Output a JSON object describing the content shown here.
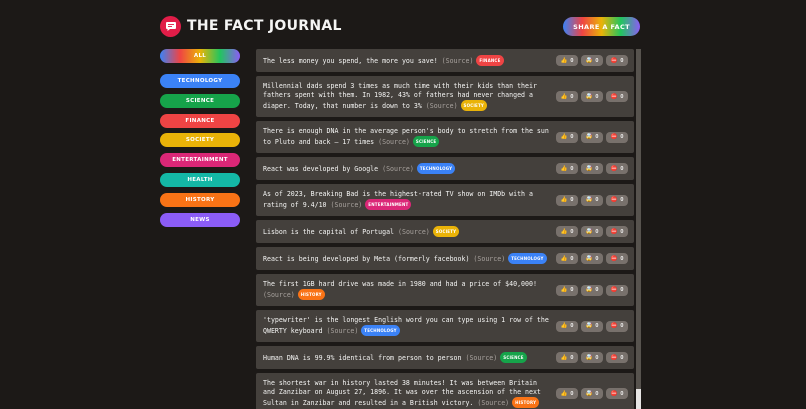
{
  "app": {
    "title": "The Fact Journal",
    "share_label": "Share a fact"
  },
  "categories": [
    {
      "key": "all",
      "label": "All",
      "color": "gradient"
    },
    {
      "key": "technology",
      "label": "Technology",
      "color": "#3b82f6"
    },
    {
      "key": "science",
      "label": "Science",
      "color": "#16a34a"
    },
    {
      "key": "finance",
      "label": "Finance",
      "color": "#ef4444"
    },
    {
      "key": "society",
      "label": "Society",
      "color": "#eab308"
    },
    {
      "key": "entertainment",
      "label": "Entertainment",
      "color": "#db2777"
    },
    {
      "key": "health",
      "label": "Health",
      "color": "#14b8a6"
    },
    {
      "key": "history",
      "label": "History",
      "color": "#f97316"
    },
    {
      "key": "news",
      "label": "News",
      "color": "#8b5cf6"
    }
  ],
  "vote_icons": {
    "interesting": "👍",
    "mindblowing": "🤯",
    "false": "⛔️"
  },
  "facts": [
    {
      "text": "The less money you spend, the more you save!",
      "source": "(Source)",
      "category": "finance",
      "tag": "FINANCE",
      "interesting": "0",
      "mindblowing": "0",
      "false": "0"
    },
    {
      "text": "Millennial dads spend 3 times as much time with their kids than their fathers spent with them. In 1982, 43% of fathers had never changed a diaper. Today, that number is down to 3%",
      "source": "(Source)",
      "category": "society",
      "tag": "SOCIETY",
      "interesting": "0",
      "mindblowing": "0",
      "false": "0"
    },
    {
      "text": "There is enough DNA in the average person's body to stretch from the sun to Pluto and back — 17 times",
      "source": "(Source)",
      "category": "science",
      "tag": "SCIENCE",
      "interesting": "0",
      "mindblowing": "0",
      "false": "0"
    },
    {
      "text": "React was developed by Google",
      "source": "(Source)",
      "category": "technology",
      "tag": "TECHNOLOGY",
      "interesting": "0",
      "mindblowing": "0",
      "false": "0"
    },
    {
      "text": "As of 2023, Breaking Bad is the highest-rated TV show on IMDb with a rating of 9.4/10",
      "source": "(Source)",
      "category": "entertainment",
      "tag": "ENTERTAINMENT",
      "interesting": "0",
      "mindblowing": "0",
      "false": "0"
    },
    {
      "text": "Lisbon is the capital of Portugal",
      "source": "(Source)",
      "category": "society",
      "tag": "SOCIETY",
      "interesting": "0",
      "mindblowing": "0",
      "false": "0"
    },
    {
      "text": "React is being developed by Meta (formerly facebook)",
      "source": "(Source)",
      "category": "technology",
      "tag": "TECHNOLOGY",
      "interesting": "0",
      "mindblowing": "0",
      "false": "0"
    },
    {
      "text": "The first 1GB hard drive was made in 1980 and had a price of $40,000!",
      "source": "(Source)",
      "category": "history",
      "tag": "HISTORY",
      "interesting": "0",
      "mindblowing": "0",
      "false": "0"
    },
    {
      "text": "'typewriter' is the longest English word you can type using 1 row of the QWERTY keyboard",
      "source": "(Source)",
      "category": "technology",
      "tag": "TECHNOLOGY",
      "interesting": "0",
      "mindblowing": "0",
      "false": "0"
    },
    {
      "text": "Human DNA is 99.9% identical from person to person",
      "source": "(Source)",
      "category": "science",
      "tag": "SCIENCE",
      "interesting": "0",
      "mindblowing": "0",
      "false": "0"
    },
    {
      "text": "The shortest war in history lasted 38 minutes! It was between Britain and Zanzibar on August 27, 1896. It was over the ascension of the next Sultan in Zanzibar and resulted in a British victory.",
      "source": "(Source)",
      "category": "history",
      "tag": "HISTORY",
      "interesting": "0",
      "mindblowing": "0",
      "false": "0"
    }
  ]
}
